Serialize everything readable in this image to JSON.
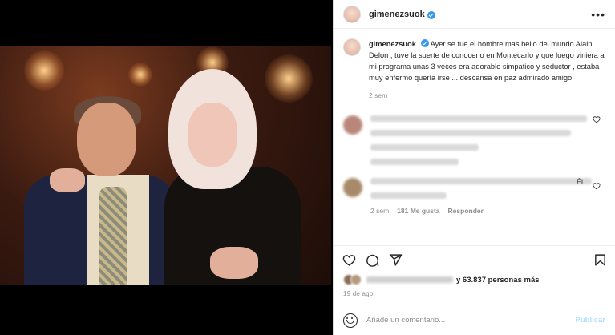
{
  "post": {
    "username": "gimenezsuok",
    "caption_username": "gimenezsuok",
    "caption": "Ayer se fue el hombre mas bello del mundo Alain Delon , tuve la suerte de conocerlo en Montecarlo y que luego viniera a mi programa unas 3 veces era adorable simpatico y seductor , estaba muy enfermo quería irse ....descansa en paz admirado amigo.",
    "caption_time": "2 sem",
    "more_label": "•••"
  },
  "comment2": {
    "time": "2 sem",
    "likes": "181 Me gusta",
    "reply": "Responder",
    "trailing": "Él"
  },
  "likes": {
    "suffix": "y 63.837 personas más"
  },
  "date": "19 de ago.",
  "add_comment": {
    "placeholder": "Añade un comentario...",
    "publish": "Publicar"
  },
  "icons": {
    "like": "heart-icon",
    "comment": "comment-icon",
    "share": "share-icon",
    "save": "bookmark-icon",
    "emoji": "emoji-icon"
  },
  "colors": {
    "verified": "#3897f0",
    "publish_disabled": "#b2dffc",
    "meta_gray": "#8e8e8e"
  }
}
